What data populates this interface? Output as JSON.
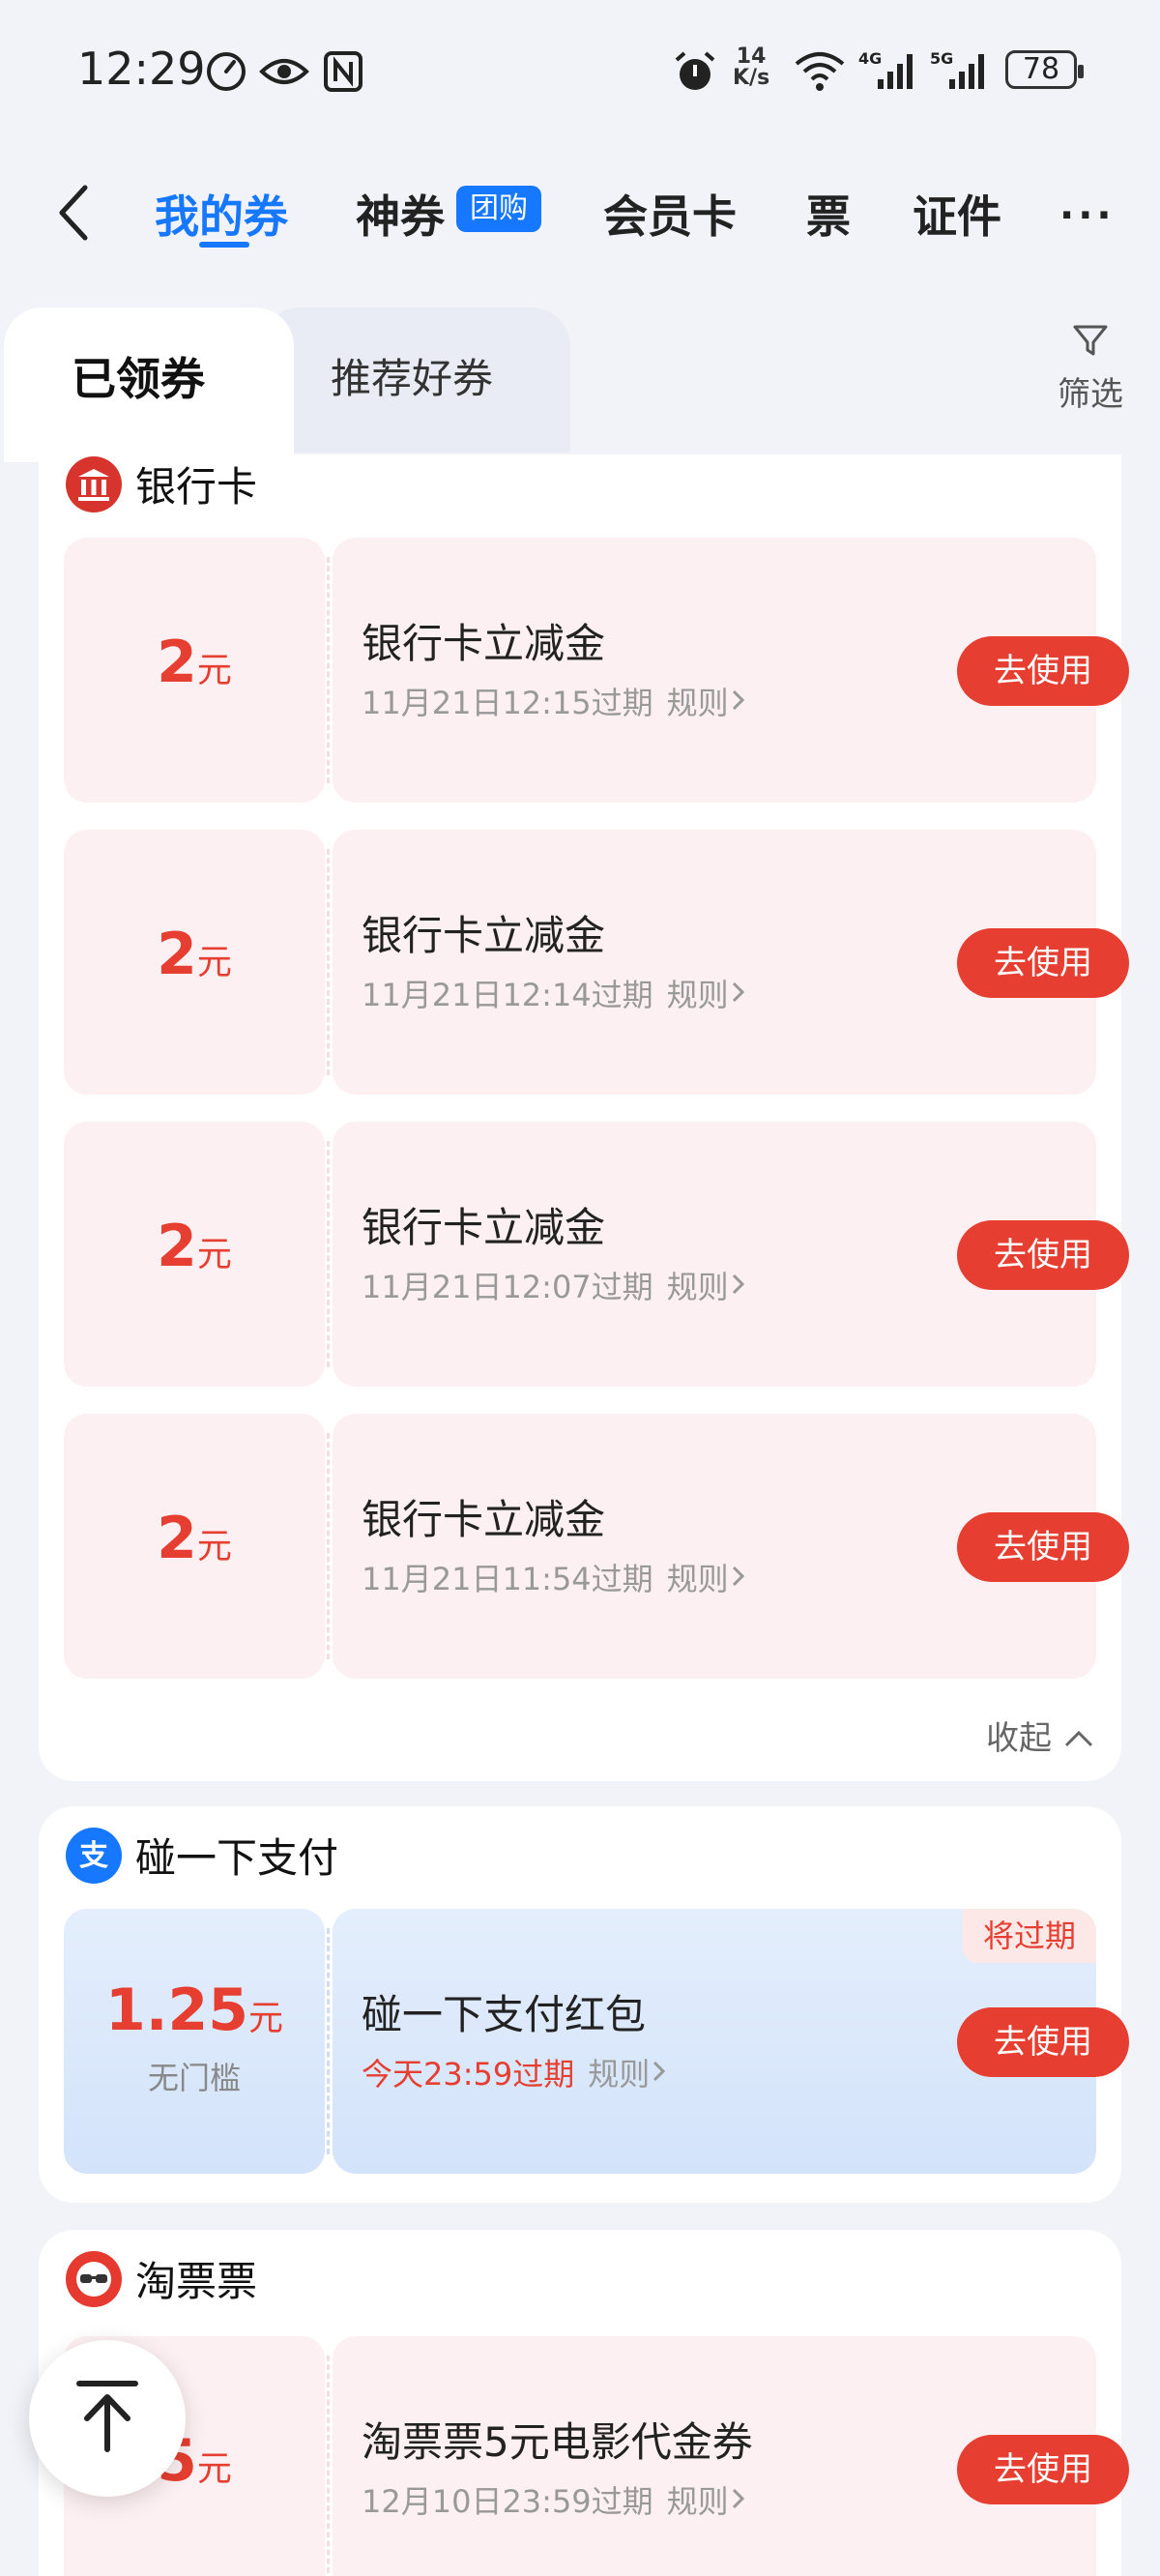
{
  "status_bar": {
    "time": "12:29",
    "net_speed_value": "14",
    "net_speed_unit": "K/s",
    "battery": "78",
    "signal_4g": "4G",
    "signal_5g": "5G"
  },
  "nav": {
    "tabs": [
      {
        "label": "我的券"
      },
      {
        "label": "神券"
      },
      {
        "label": "会员卡"
      },
      {
        "label": "票"
      },
      {
        "label": "证件"
      }
    ],
    "badge": "团购",
    "more": "···"
  },
  "subtabs": {
    "active": "已领券",
    "inactive": "推荐好券",
    "filter": "筛选"
  },
  "sections": [
    {
      "title": "银行卡",
      "coupons": [
        {
          "amount": "2",
          "unit": "元",
          "name": "银行卡立减金",
          "expiry": "11月21日12:15过期",
          "rule": "规则",
          "button": "去使用"
        },
        {
          "amount": "2",
          "unit": "元",
          "name": "银行卡立减金",
          "expiry": "11月21日12:14过期",
          "rule": "规则",
          "button": "去使用"
        },
        {
          "amount": "2",
          "unit": "元",
          "name": "银行卡立减金",
          "expiry": "11月21日12:07过期",
          "rule": "规则",
          "button": "去使用"
        },
        {
          "amount": "2",
          "unit": "元",
          "name": "银行卡立减金",
          "expiry": "11月21日11:54过期",
          "rule": "规则",
          "button": "去使用"
        }
      ],
      "collapse": "收起"
    },
    {
      "title": "碰一下支付",
      "coupons": [
        {
          "amount": "1.25",
          "unit": "元",
          "sub": "无门槛",
          "name": "碰一下支付红包",
          "expiry": "今天23:59过期",
          "rule": "规则",
          "button": "去使用",
          "tag": "将过期"
        }
      ]
    },
    {
      "title": "淘票票",
      "coupons": [
        {
          "amount": "5",
          "unit": "元",
          "name": "淘票票5元电影代金券",
          "expiry": "12月10日23:59过期",
          "rule": "规则",
          "button": "去使用"
        }
      ]
    }
  ],
  "colors": {
    "accent": "#1677ff",
    "red": "#e63e30",
    "coupon_bg": "#fdf0f3"
  }
}
